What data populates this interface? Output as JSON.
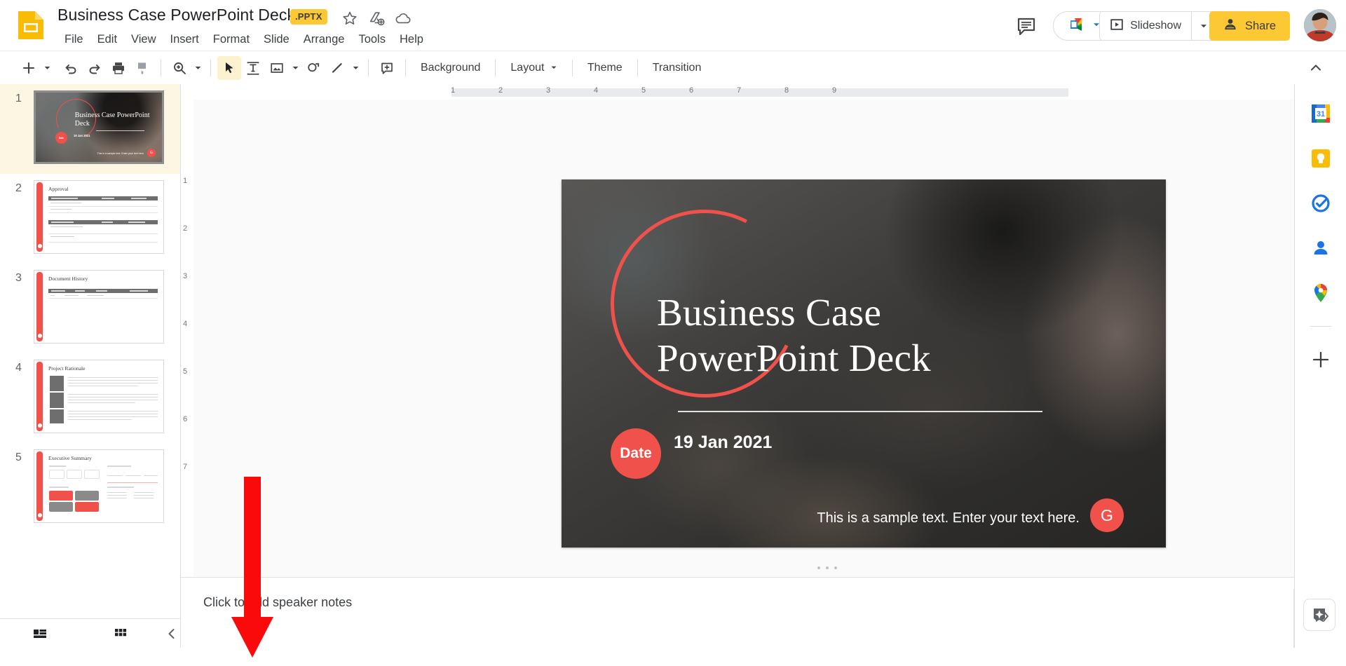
{
  "app": {
    "logo_icon": "google-slides-icon",
    "doc_title": "Business Case  PowerPoint Deck",
    "file_badge": ".PPTX",
    "title_icons": [
      "star-icon",
      "move-to-drive-icon",
      "cloud-saved-icon"
    ]
  },
  "menubar": {
    "items": [
      "File",
      "Edit",
      "View",
      "Insert",
      "Format",
      "Slide",
      "Arrange",
      "Tools",
      "Help"
    ]
  },
  "header_actions": {
    "comment_icon": "comment-history-icon",
    "meet_icon": "google-meet-icon",
    "meet_caret": "chevron-down-icon",
    "slideshow_label": "Slideshow",
    "slideshow_icon": "present-icon",
    "slideshow_caret": "chevron-down-icon",
    "share_label": "Share",
    "share_icon": "person-add-icon",
    "avatar": "user-avatar"
  },
  "toolbar": {
    "new_slide_icon": "plus-icon",
    "new_slide_caret": "chevron-down-icon",
    "undo_icon": "undo-icon",
    "redo_icon": "redo-icon",
    "print_icon": "print-icon",
    "paint_format_icon": "paint-format-icon",
    "zoom_icon": "zoom-icon",
    "zoom_caret": "chevron-down-icon",
    "select_icon": "cursor-select-icon",
    "textbox_icon": "text-box-icon",
    "image_icon": "insert-image-icon",
    "image_caret": "chevron-down-icon",
    "shape_icon": "shape-icon",
    "line_icon": "line-icon",
    "line_caret": "chevron-down-icon",
    "comment_add_icon": "add-comment-icon",
    "background_label": "Background",
    "layout_label": "Layout",
    "layout_caret": "chevron-down-icon",
    "theme_label": "Theme",
    "transition_label": "Transition",
    "collapse_icon": "chevron-up-icon"
  },
  "filmstrip": {
    "slides": [
      {
        "number": "1",
        "title": "Business Case PowerPoint Deck",
        "selected": true
      },
      {
        "number": "2",
        "title": "Approval",
        "selected": false
      },
      {
        "number": "3",
        "title": "Document History",
        "selected": false
      },
      {
        "number": "4",
        "title": "Project Rationale",
        "selected": false
      },
      {
        "number": "5",
        "title": "Executive Summary",
        "selected": false
      }
    ],
    "bottom": {
      "filmstrip_view_icon": "filmstrip-view-icon",
      "grid_view_icon": "grid-view-icon",
      "collapse_icon": "chevron-left-icon"
    }
  },
  "ruler": {
    "h_ticks": [
      "1",
      "2",
      "3",
      "4",
      "5",
      "6",
      "7",
      "8",
      "9"
    ],
    "v_ticks": [
      "1",
      "2",
      "3",
      "4",
      "5",
      "6",
      "7"
    ]
  },
  "slide": {
    "title_line1": "Business Case",
    "title_line2": "PowerPoint Deck",
    "date_badge": "Date",
    "date_value": "19 Jan 2021",
    "sample_text": "This is a sample text. Enter your text here.",
    "logo_letter": "G",
    "accent_color": "#f0514b"
  },
  "notes": {
    "placeholder": "Click to add speaker notes"
  },
  "rail": {
    "items": [
      {
        "icon": "google-calendar-icon",
        "label": "Calendar"
      },
      {
        "icon": "google-keep-icon",
        "label": "Keep"
      },
      {
        "icon": "google-tasks-icon",
        "label": "Tasks"
      },
      {
        "icon": "google-contacts-icon",
        "label": "Contacts"
      },
      {
        "icon": "google-maps-icon",
        "label": "Maps"
      }
    ],
    "add_icon": "plus-icon",
    "gemini_icon": "gemini-sparkle-icon",
    "expand_icon": "chevron-right-icon"
  },
  "annotation": {
    "arrow_color": "#fa0a0a"
  }
}
